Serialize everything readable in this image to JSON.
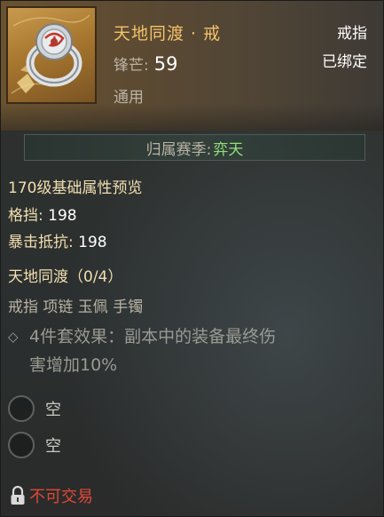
{
  "item": {
    "name": "天地同渡 · 戒",
    "stat_label": "锋芒:",
    "stat_value": "59",
    "usage": "通用",
    "slot_type": "戒指",
    "bind_status": "已绑定",
    "icon": "ring-icon"
  },
  "season": {
    "label": "归属赛季:",
    "value": "弈天"
  },
  "base_attributes": {
    "title": "170级基础属性预览",
    "rows": [
      {
        "label": "格挡:",
        "value": "198"
      },
      {
        "label": "暴击抵抗:",
        "value": "198"
      }
    ]
  },
  "set": {
    "title": "天地同渡（0/4）",
    "pieces": "戒指 项链 玉佩 手镯",
    "effect_line1": "4件套效果：副本中的装备最终伤",
    "effect_line2": "害增加10%"
  },
  "sockets": [
    {
      "label": "空"
    },
    {
      "label": "空"
    }
  ],
  "trade": {
    "label": "不可交易",
    "icon": "lock-icon"
  },
  "colors": {
    "name": "#f4c26a",
    "season_value": "#8fe07a",
    "untradeable": "#e04838"
  }
}
